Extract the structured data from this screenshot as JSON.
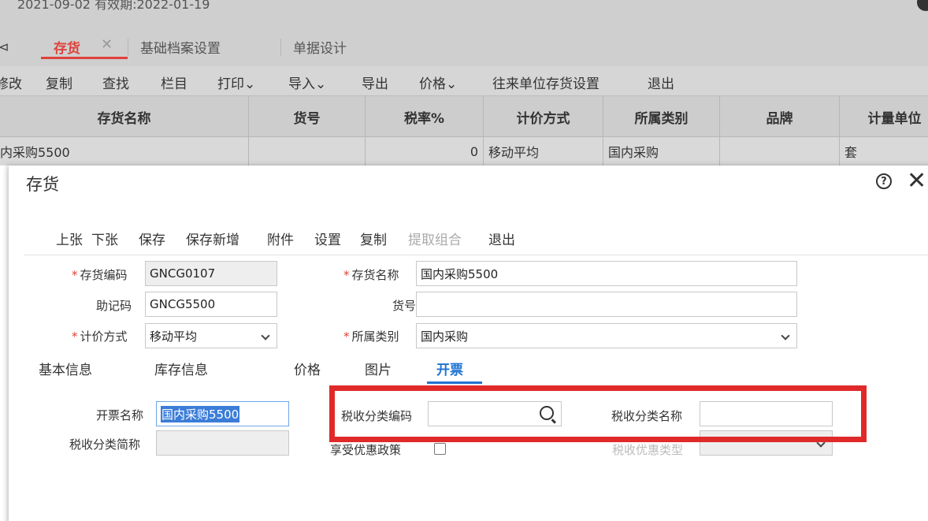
{
  "background": {
    "top_text": "2021-09-02  有效期:2022-01-19",
    "tabs": {
      "left_glyph": "⊲",
      "active": "存货",
      "active_close": "✕",
      "items": [
        "基础档案设置",
        "单据设计"
      ]
    },
    "toolbar": [
      "修改",
      "复制",
      "查找",
      "栏目",
      "打印⌄",
      "导入⌄",
      "导出",
      "价格⌄",
      "往来单位存货设置",
      "退出"
    ],
    "grid": {
      "headers": [
        "存货名称",
        "货号",
        "税率%",
        "计价方式",
        "所属类别",
        "品牌",
        "计量单位"
      ],
      "row": [
        "内采购5500",
        "",
        "0",
        "移动平均",
        "国内采购",
        "",
        "套"
      ]
    }
  },
  "modal": {
    "title": "存货",
    "help_glyph": "?",
    "close_glyph": "✕",
    "toolbar": [
      {
        "label": "上张",
        "enabled": true
      },
      {
        "label": "下张",
        "enabled": true
      },
      {
        "label": "保存",
        "enabled": true
      },
      {
        "label": "保存新增",
        "enabled": true
      },
      {
        "label": "附件",
        "enabled": true
      },
      {
        "label": "设置",
        "enabled": true
      },
      {
        "label": "复制",
        "enabled": true
      },
      {
        "label": "提取组合",
        "enabled": false
      },
      {
        "label": "退出",
        "enabled": true
      }
    ],
    "form": {
      "required_mark": "*",
      "code_label": "存货编码",
      "code_value": "GNCG0107",
      "name_label": "存货名称",
      "name_value": "国内采购5500",
      "mnemonic_label": "助记码",
      "mnemonic_value": "GNCG5500",
      "item_no_label": "货号",
      "item_no_value": "",
      "valuation_label": "计价方式",
      "valuation_value": "移动平均",
      "category_label": "所属类别",
      "category_value": "国内采购"
    },
    "sub_tabs": [
      "基本信息",
      "库存信息",
      "价格",
      "图片",
      "开票"
    ],
    "invoice": {
      "invoice_name_label": "开票名称",
      "invoice_name_value": "国内采购5500",
      "tax_class_code_label": "税收分类编码",
      "tax_class_code_value": "",
      "tax_class_name_label": "税收分类名称",
      "tax_class_name_value": "",
      "tax_class_short_label": "税收分类简称",
      "tax_class_short_value": "",
      "preferential_label": "享受优惠政策",
      "preferential_type_label": "税收优惠类型"
    }
  },
  "colors": {
    "accent_red": "#e0413a",
    "accent_blue": "#1e73d2",
    "highlight_box": "#e02a2a"
  }
}
